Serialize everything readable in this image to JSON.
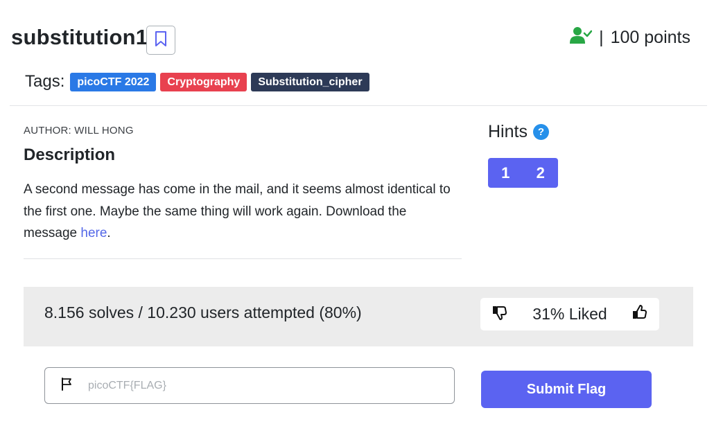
{
  "challenge": {
    "title": "substitution1",
    "points_label": "100 points",
    "points_separator": "|"
  },
  "tags": {
    "label": "Tags:",
    "items": [
      {
        "label": "picoCTF 2022",
        "color": "#2a79e6"
      },
      {
        "label": "Cryptography",
        "color": "#e8414f"
      },
      {
        "label": "Substitution_cipher",
        "color": "#2d3a57"
      }
    ]
  },
  "description": {
    "author": "AUTHOR: WILL HONG",
    "heading": "Description",
    "body_text": "A second message has come in the mail, and it seems almost identical to the first one. Maybe the same thing will work again. Download the message ",
    "link_text": "here",
    "body_end": "."
  },
  "hints": {
    "title": "Hints",
    "help_glyph": "?",
    "buttons": [
      "1",
      "2"
    ]
  },
  "stats": {
    "solves_text": "8.156 solves / 10.230 users attempted (80%)",
    "liked_text": "31% Liked"
  },
  "flag": {
    "placeholder": "picoCTF{FLAG}",
    "submit_label": "Submit Flag"
  },
  "icons": {
    "bookmark": "bookmark-icon",
    "solved_user": "user-check-icon",
    "thumbs_down": "thumbs-down-icon",
    "thumbs_up": "thumbs-up-icon",
    "flag": "flag-icon"
  },
  "colors": {
    "primary": "#5b63f1",
    "link": "#5468e8",
    "solved_green": "#28a745",
    "stats_bg": "#ececec"
  }
}
